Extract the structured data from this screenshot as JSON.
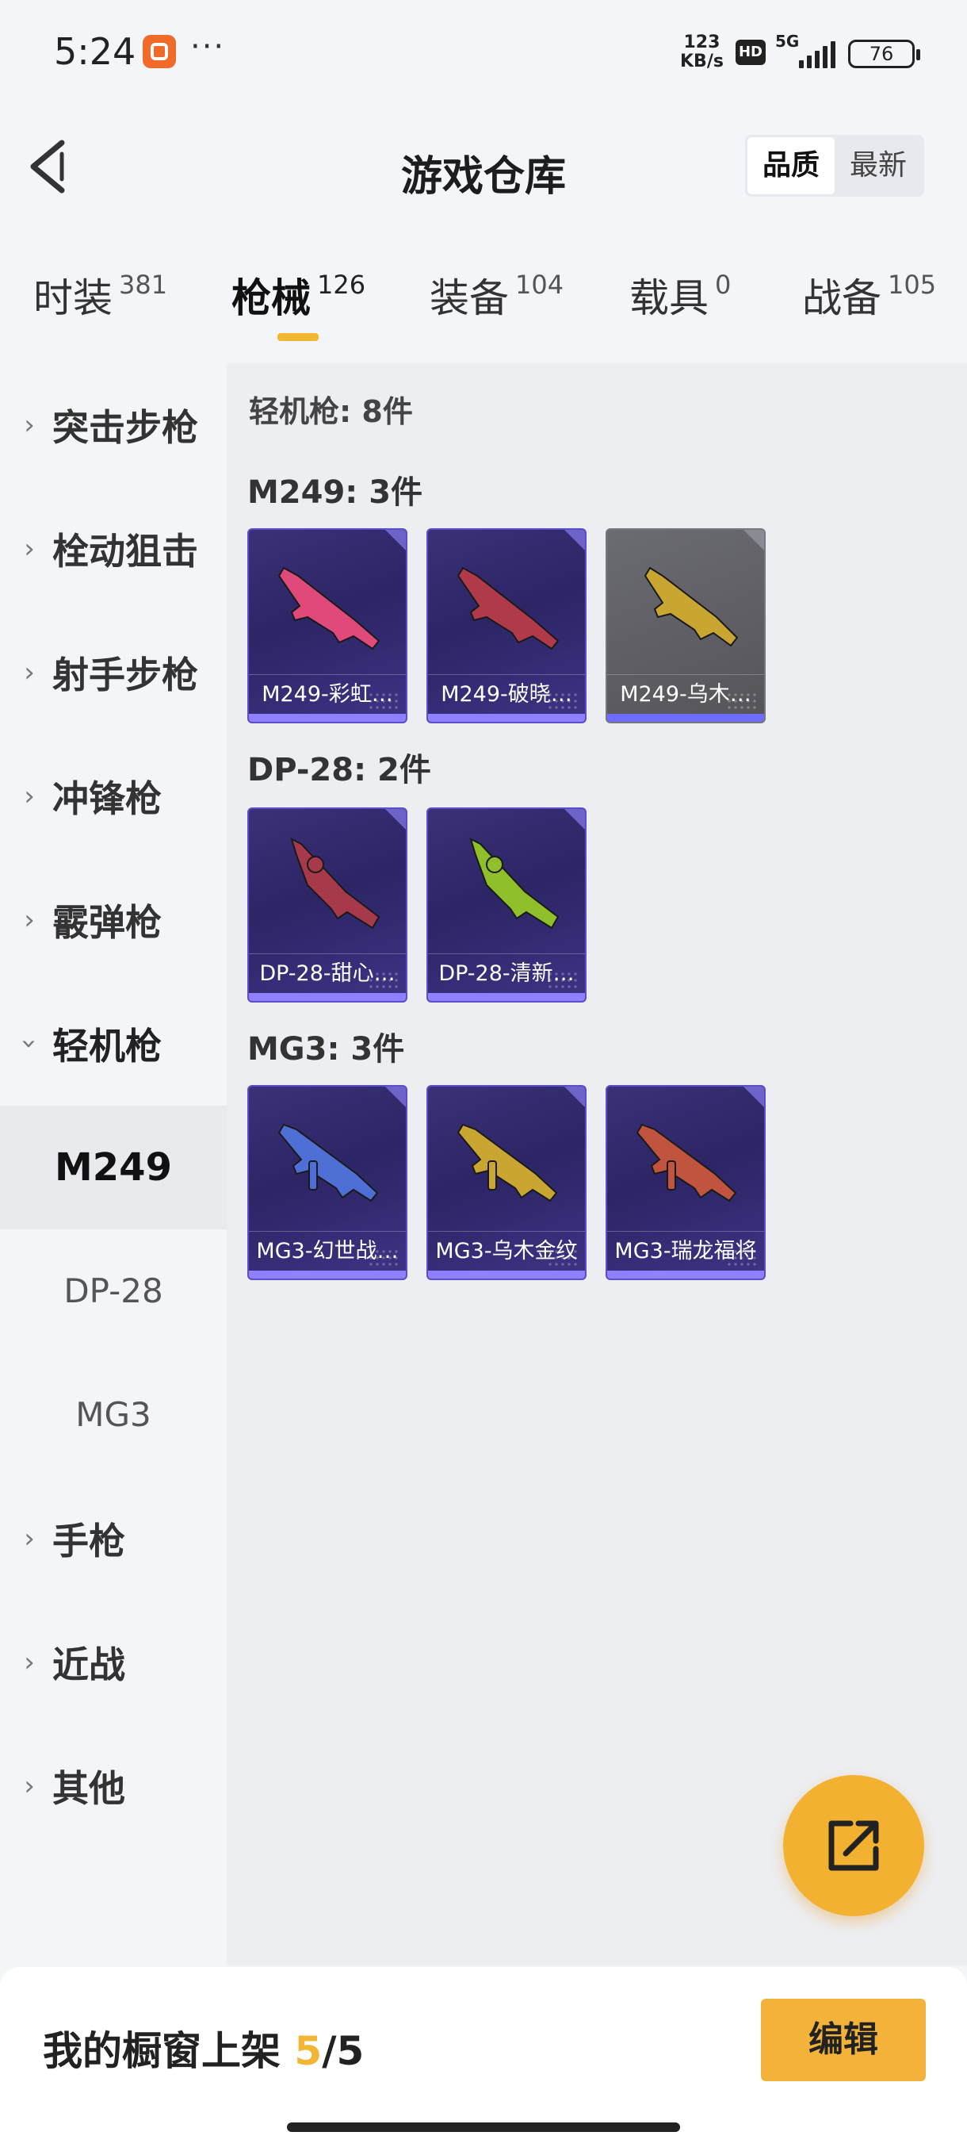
{
  "status_bar": {
    "time": "5:24",
    "more": "···",
    "net_speed_value": "123",
    "net_speed_unit": "KB/s",
    "hd": "HD",
    "network": "5G",
    "battery": "76"
  },
  "header": {
    "title": "游戏仓库",
    "sort_options": [
      "品质",
      "最新"
    ],
    "sort_selected": "品质"
  },
  "tabs": [
    {
      "label": "时装",
      "count": "381"
    },
    {
      "label": "枪械",
      "count": "126",
      "active": true
    },
    {
      "label": "装备",
      "count": "104"
    },
    {
      "label": "载具",
      "count": "0"
    },
    {
      "label": "战备",
      "count": "105"
    }
  ],
  "sidebar": {
    "items": [
      {
        "label": "突击步枪"
      },
      {
        "label": "栓动狙击"
      },
      {
        "label": "射手步枪"
      },
      {
        "label": "冲锋枪"
      },
      {
        "label": "霰弹枪"
      },
      {
        "label": "轻机枪",
        "open": true
      },
      {
        "label": "手枪"
      },
      {
        "label": "近战"
      },
      {
        "label": "其他"
      }
    ],
    "sub_items": [
      {
        "label": "M249",
        "active": true
      },
      {
        "label": "DP-28"
      },
      {
        "label": "MG3"
      }
    ]
  },
  "content": {
    "heading": "轻机枪: 8件",
    "groups": [
      {
        "title": "M249: 3件",
        "items": [
          {
            "name": "M249-彩虹…",
            "tint": "#e04a7a"
          },
          {
            "name": "M249-破晓…",
            "tint": "#b03a4a"
          },
          {
            "name": "M249-乌木…",
            "tint": "#c9a531"
          }
        ]
      },
      {
        "title": "DP-28: 2件",
        "items": [
          {
            "name": "DP-28-甜心…",
            "tint": "#a73a4a"
          },
          {
            "name": "DP-28-清新…",
            "tint": "#8fbf2a"
          }
        ]
      },
      {
        "title": "MG3: 3件",
        "items": [
          {
            "name": "MG3-幻世战…",
            "tint": "#4d6fd6"
          },
          {
            "name": "MG3-乌木金纹",
            "tint": "#c9a531"
          },
          {
            "name": "MG3-瑞龙福将",
            "tint": "#c0543e"
          }
        ]
      }
    ]
  },
  "bottom_bar": {
    "showcase_label": "我的橱窗上架",
    "showcase_current": "5",
    "showcase_sep": "/",
    "showcase_total": "5",
    "edit_label": "编辑"
  },
  "colors": {
    "accent": "#f2b632",
    "card_purple": "#2c2565",
    "card_gray": "#5a5a60"
  }
}
